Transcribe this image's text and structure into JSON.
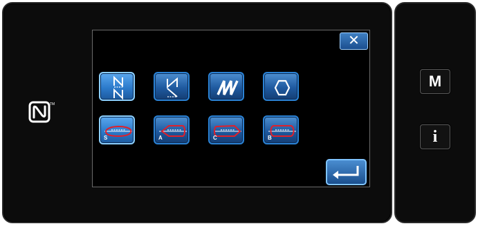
{
  "dialog": {
    "close_icon": "close-x-icon",
    "close_glyph": "✕",
    "patterns_row1": [
      {
        "id": "pattern-n-shape-stitch",
        "icon": "n-stitch-icon"
      },
      {
        "id": "pattern-reverse-n-stitch",
        "icon": "reverse-n-stitch-icon"
      },
      {
        "id": "pattern-m-stitch",
        "icon": "m-stitch-icon"
      },
      {
        "id": "pattern-polygon-stitch",
        "icon": "hexagon-icon"
      }
    ],
    "patterns_row2": [
      {
        "id": "pattern-s",
        "letter": "S",
        "icon": "seam-loop-s-icon"
      },
      {
        "id": "pattern-a",
        "letter": "A",
        "icon": "seam-loop-a-icon"
      },
      {
        "id": "pattern-c",
        "letter": "C",
        "icon": "seam-loop-c-icon"
      },
      {
        "id": "pattern-b",
        "letter": "B",
        "icon": "seam-loop-b-icon"
      }
    ],
    "enter_icon": "enter-arrow-icon"
  },
  "side_panel": {
    "m_label": "M",
    "info_label": "i"
  },
  "colors": {
    "button_blue": "#1f5aa0",
    "active_blue": "#2c7bcc",
    "loop_red": "#e0202a"
  }
}
